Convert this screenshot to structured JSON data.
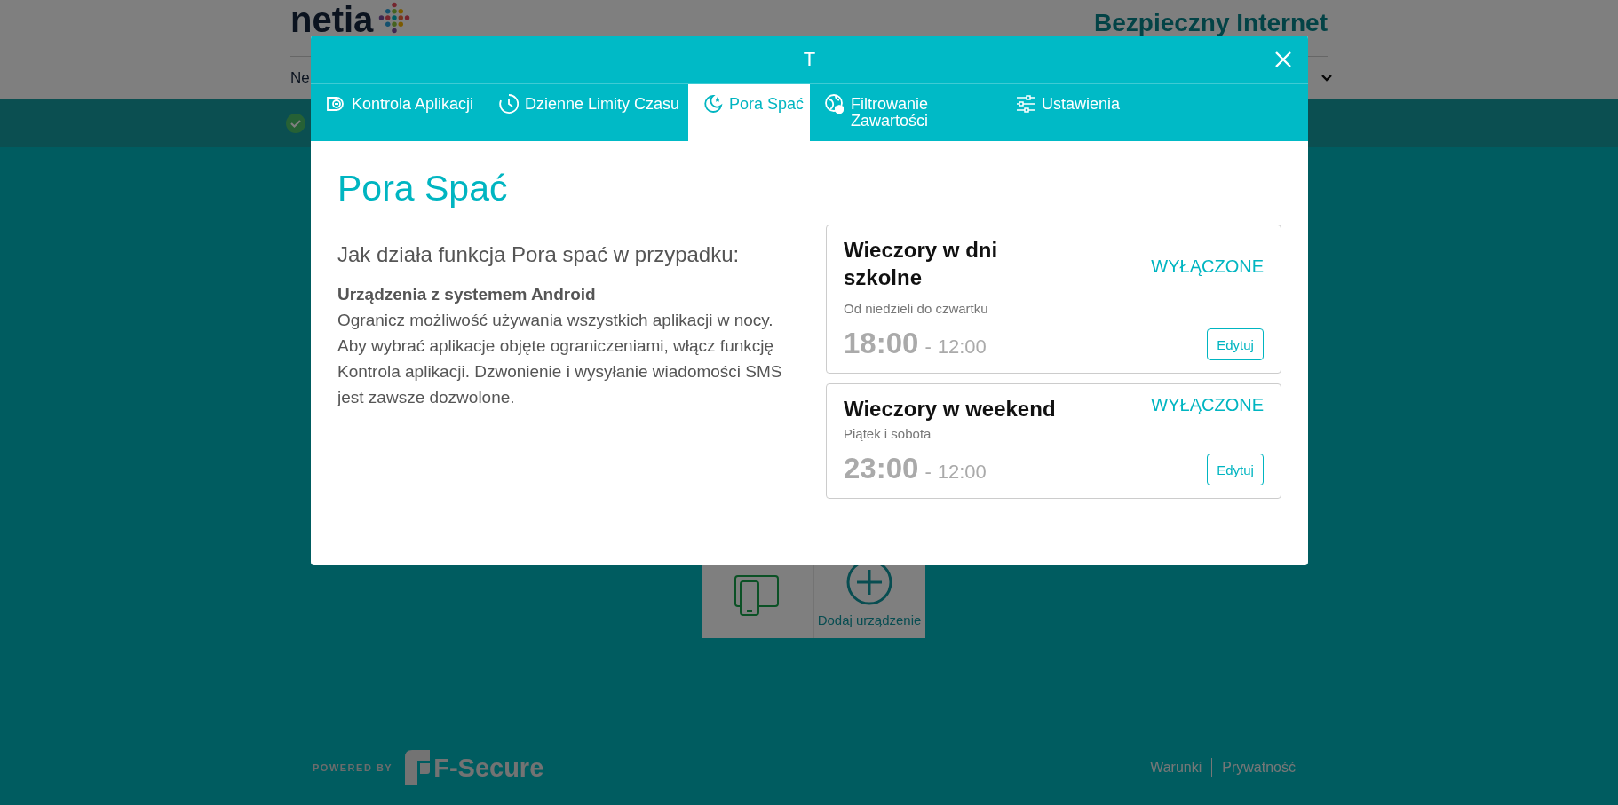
{
  "header": {
    "logo": "netia",
    "title": "Bezpieczny Internet",
    "nav_item": "Ne"
  },
  "devices": [
    {
      "kind": "device"
    },
    {
      "kind": "add",
      "label": "Dodaj urządzenie"
    }
  ],
  "footer": {
    "powered_by": "POWERED BY",
    "brand": "F-Secure",
    "links": [
      "Warunki",
      "Prywatność"
    ]
  },
  "modal": {
    "title": "T",
    "tabs": [
      {
        "kind": "apps",
        "label": "Kontrola Aplikacji",
        "selected": false
      },
      {
        "kind": "limits",
        "label": "Dzienne Limity Czasu",
        "selected": false
      },
      {
        "kind": "bedtime",
        "label": "Pora Spać",
        "selected": true
      },
      {
        "kind": "filter",
        "label": "Filtrowanie Zawartości",
        "selected": false
      },
      {
        "kind": "settings",
        "label": "Ustawienia",
        "selected": false
      }
    ],
    "heading": "Pora Spać",
    "intro": "Jak działa funkcja Pora spać w przypadku:",
    "section_title": "Urządzenia z systemem Android",
    "description": "Ogranicz możliwość używania wszystkich aplikacji w nocy. Aby wybrać aplikacje objęte ograniczeniami, włącz funkcję Kontrola aplikacji. Dzwonienie i wysyłanie wiadomości SMS jest zawsze dozwolone.",
    "schedules": [
      {
        "title": "Wieczory w dni szkolne",
        "status": "WYŁĄCZONE",
        "days": "Od niedzieli do czwartku",
        "start": "18:00",
        "separator": "-",
        "end": "12:00",
        "button": "Edytuj"
      },
      {
        "title": "Wieczory w weekend",
        "status": "WYŁĄCZONE",
        "days": "Piątek i sobota",
        "start": "23:00",
        "separator": "-",
        "end": "12:00",
        "button": "Edytuj"
      }
    ]
  }
}
